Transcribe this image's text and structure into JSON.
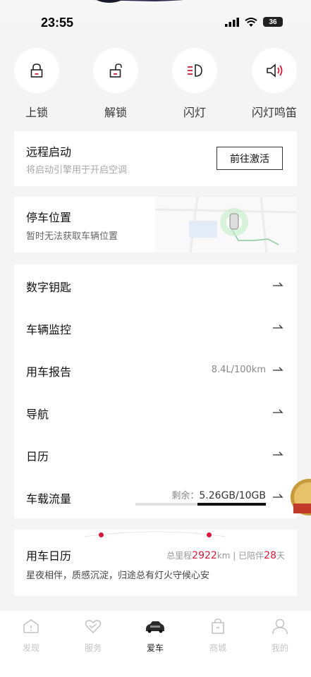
{
  "status_bar": {
    "time": "23:55",
    "battery": "36"
  },
  "quick_actions": [
    {
      "label": "上锁",
      "icon": "lock-icon"
    },
    {
      "label": "解锁",
      "icon": "unlock-icon"
    },
    {
      "label": "闪灯",
      "icon": "headlight-icon"
    },
    {
      "label": "闪灯鸣笛",
      "icon": "horn-icon"
    }
  ],
  "remote_start": {
    "title": "远程启动",
    "subtitle": "将启动引擎用于开启空调",
    "button_label": "前往激活"
  },
  "parking": {
    "title": "停车位置",
    "subtitle": "暂时无法获取车辆位置"
  },
  "menu": {
    "items": [
      {
        "label": "数字钥匙"
      },
      {
        "label": "车辆监控"
      },
      {
        "label": "用车报告",
        "value": "8.4L/100km"
      },
      {
        "label": "导航"
      },
      {
        "label": "日历"
      },
      {
        "label": "车载流量",
        "remaining_label": "剩余：",
        "remaining_value": "5.26GB/10GB",
        "remaining_fraction": 0.526
      }
    ]
  },
  "car_calendar": {
    "title": "用车日历",
    "mileage_label": "总里程",
    "mileage_value": "2922",
    "mileage_unit": "km",
    "separator": "|",
    "companion_label": "已陪伴",
    "companion_days": "28",
    "companion_unit": "天",
    "description": "星夜相伴，质感沉淀，归途总有灯火守候心安"
  },
  "tabbar": {
    "tabs": [
      {
        "label": "发现",
        "icon": "discover-icon",
        "active": false
      },
      {
        "label": "服务",
        "icon": "service-heart-icon",
        "active": false
      },
      {
        "label": "爱车",
        "icon": "car-icon",
        "active": true
      },
      {
        "label": "商城",
        "icon": "shopping-bag-icon",
        "active": false
      },
      {
        "label": "我的",
        "icon": "profile-icon",
        "active": false
      }
    ]
  },
  "colors": {
    "accent": "#d61a3c",
    "background": "#f4f4f4",
    "card": "#ffffff"
  }
}
